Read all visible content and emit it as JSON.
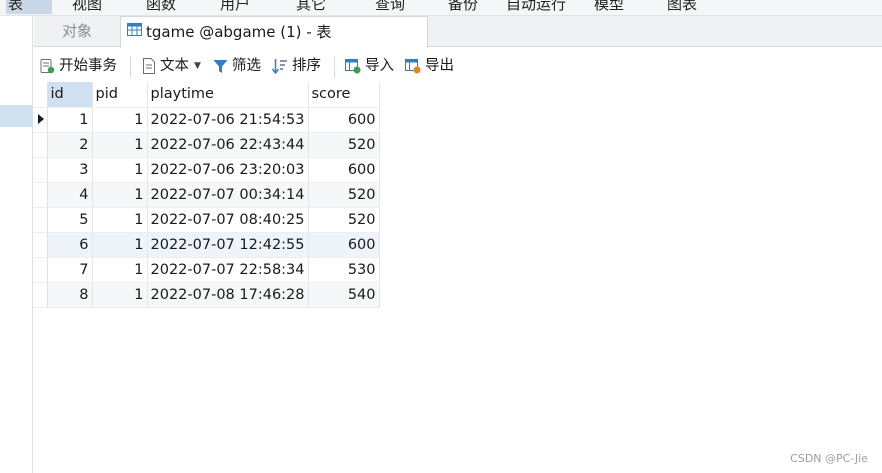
{
  "menu": {
    "items": [
      {
        "label": "表",
        "active": true
      },
      {
        "label": "视图"
      },
      {
        "label": "函数"
      },
      {
        "label": "用户"
      },
      {
        "label": "其它"
      },
      {
        "label": "查询"
      },
      {
        "label": "备份"
      },
      {
        "label": "自动运行"
      },
      {
        "label": "模型"
      },
      {
        "label": "图表"
      }
    ]
  },
  "tabs": {
    "objects": "对象",
    "table": "tgame @abgame (1) - 表"
  },
  "toolbar": {
    "begin_transaction": "开始事务",
    "text": "文本",
    "filter": "筛选",
    "sort": "排序",
    "import": "导入",
    "export": "导出"
  },
  "grid": {
    "columns": [
      "id",
      "pid",
      "playtime",
      "score"
    ],
    "rows": [
      [
        "1",
        "1",
        "2022-07-06 21:54:53",
        "600"
      ],
      [
        "2",
        "1",
        "2022-07-06 22:43:44",
        "520"
      ],
      [
        "3",
        "1",
        "2022-07-06 23:20:03",
        "600"
      ],
      [
        "4",
        "1",
        "2022-07-07 00:34:14",
        "520"
      ],
      [
        "5",
        "1",
        "2022-07-07 08:40:25",
        "520"
      ],
      [
        "6",
        "1",
        "2022-07-07 12:42:55",
        "600"
      ],
      [
        "7",
        "1",
        "2022-07-07 22:58:34",
        "530"
      ],
      [
        "8",
        "1",
        "2022-07-08 17:46:28",
        "540"
      ]
    ]
  },
  "watermark": "CSDN @PC-Jie",
  "colors": {
    "selection": "#cfe0f1",
    "alt_row": "#f6f7f8",
    "accent_icon": "#2f7ec9"
  }
}
